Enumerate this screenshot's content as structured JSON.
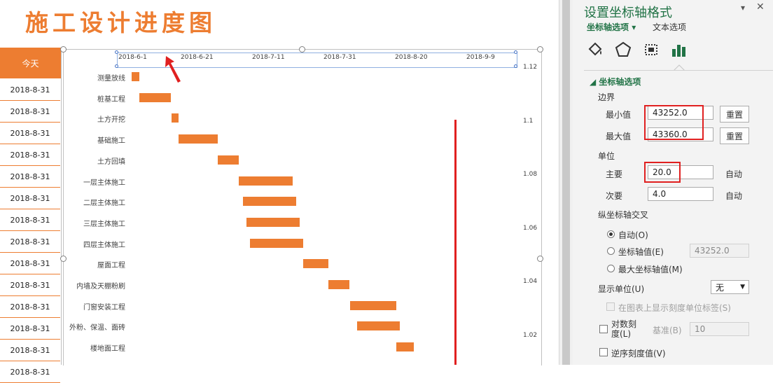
{
  "sheet": {
    "title": "施工设计进度图",
    "today_header": "今天",
    "today_dates": [
      "2018-8-31",
      "2018-8-31",
      "2018-8-31",
      "2018-8-31",
      "2018-8-31",
      "2018-8-31",
      "2018-8-31",
      "2018-8-31",
      "2018-8-31",
      "2018-8-31",
      "2018-8-31",
      "2018-8-31",
      "2018-8-31",
      "2018-8-31"
    ]
  },
  "chart_data": {
    "type": "bar",
    "orientation": "horizontal-gantt",
    "x_ticks": [
      "2018-6-1",
      "2018-6-21",
      "2018-7-11",
      "2018-7-31",
      "2018-8-20",
      "2018-9-9"
    ],
    "xlim": [
      "2018-6-1",
      "2018-9-16"
    ],
    "y2_ticks": [
      "1.12",
      "1.1",
      "1.08",
      "1.06",
      "1.04",
      "1.02"
    ],
    "tasks": [
      {
        "name": "测量放线",
        "start": "2018-6-5",
        "end": "2018-6-7"
      },
      {
        "name": "桩基工程",
        "start": "2018-6-7",
        "end": "2018-6-16"
      },
      {
        "name": "土方开挖",
        "start": "2018-6-16",
        "end": "2018-6-18"
      },
      {
        "name": "基础施工",
        "start": "2018-6-18",
        "end": "2018-6-29"
      },
      {
        "name": "土方回填",
        "start": "2018-6-29",
        "end": "2018-7-5"
      },
      {
        "name": "一层主体施工",
        "start": "2018-7-5",
        "end": "2018-7-20"
      },
      {
        "name": "二层主体施工",
        "start": "2018-7-6",
        "end": "2018-7-21"
      },
      {
        "name": "三层主体施工",
        "start": "2018-7-7",
        "end": "2018-7-22"
      },
      {
        "name": "四层主体施工",
        "start": "2018-7-8",
        "end": "2018-7-23"
      },
      {
        "name": "屋面工程",
        "start": "2018-7-23",
        "end": "2018-7-30"
      },
      {
        "name": "内墙及天棚粉刷",
        "start": "2018-7-30",
        "end": "2018-8-5"
      },
      {
        "name": "门窗安装工程",
        "start": "2018-8-5",
        "end": "2018-8-18"
      },
      {
        "name": "外粉、保温、面砖",
        "start": "2018-8-7",
        "end": "2018-8-19"
      },
      {
        "name": "楼地面工程",
        "start": "2018-8-18",
        "end": "2018-8-23"
      }
    ],
    "today_marker": "2018-8-31",
    "bar_color": "#ed7d31",
    "today_line_color": "#e02020"
  },
  "pane": {
    "title": "设置坐标轴格式",
    "tab_axis": "坐标轴选项",
    "tab_text": "文本选项",
    "section": "坐标轴选项",
    "bounds": "边界",
    "min_label": "最小值",
    "min_value": "43252.0",
    "max_label": "最大值",
    "max_value": "43360.0",
    "reset": "重置",
    "units": "单位",
    "major_label": "主要",
    "major_value": "20.0",
    "minor_label": "次要",
    "minor_value": "4.0",
    "auto": "自动",
    "cross": "纵坐标轴交叉",
    "cross_auto": "自动(O)",
    "cross_value_label": "坐标轴值(E)",
    "cross_value": "43252.0",
    "cross_max": "最大坐标轴值(M)",
    "display_units": "显示单位(U)",
    "display_units_value": "无",
    "show_units_label": "在图表上显示刻度单位标签(S)",
    "log_scale": "对数刻度(L)",
    "log_line1": "对数刻",
    "log_line2": "度(L)",
    "base_label": "基准(B)",
    "base_value": "10",
    "reverse": "逆序刻度值(V)",
    "accent": "#217346",
    "highlight": "#e02020"
  }
}
